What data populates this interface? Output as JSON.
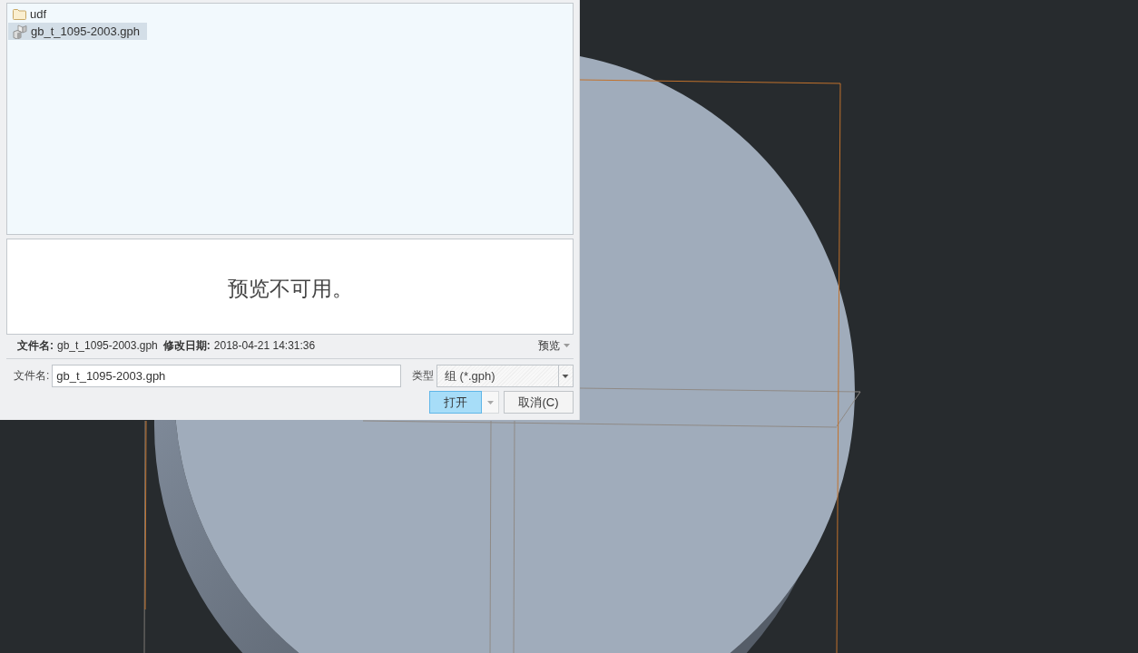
{
  "file_dialog": {
    "files": [
      {
        "kind": "folder",
        "name": "udf",
        "selected": false
      },
      {
        "kind": "file",
        "name": "gb_t_1095-2003.gph",
        "selected": true
      }
    ],
    "preview": {
      "message": "预览不可用。"
    },
    "details": [
      {
        "label": "文件名:",
        "value": "gb_t_1095-2003.gph"
      },
      {
        "label": "修改日期:",
        "value": "2018-04-21 14:31:36"
      }
    ],
    "preview_toggle": "预览",
    "file_name": {
      "label": "文件名:",
      "value": "gb_t_1095-2003.gph"
    },
    "file_type": {
      "label": "类型",
      "value": "组 (*.gph)"
    },
    "buttons": [
      {
        "kind": "split",
        "label": "打开",
        "default": true
      },
      {
        "kind": "plain",
        "label": "取消(C)",
        "default": false
      }
    ]
  }
}
